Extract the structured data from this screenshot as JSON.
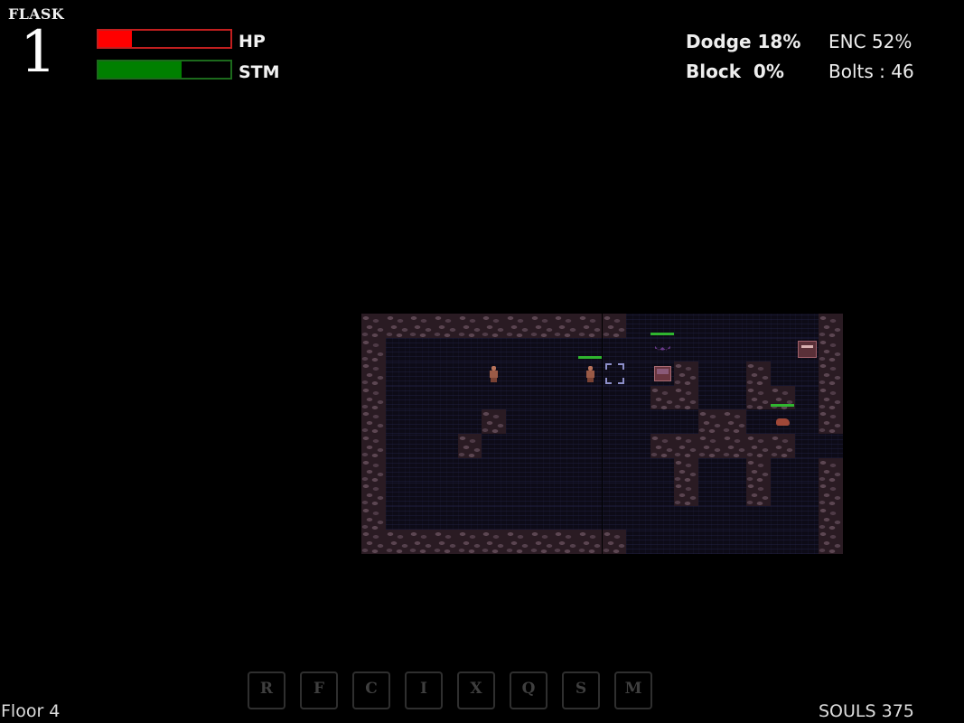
{
  "hud": {
    "flask_label": "FLASK",
    "flask_count": "1",
    "hp_label": "HP",
    "hp_fraction": 0.25,
    "hp_color": "#ff0000",
    "stm_label": "STM",
    "stm_fraction": 0.63,
    "stm_color": "#008000",
    "dodge": "Dodge 18%",
    "block": "Block  0%",
    "enc": "ENC 52%",
    "bolts": "Bolts : 46",
    "floor": "Floor 4",
    "souls": "SOULS 375"
  },
  "hotkeys": [
    {
      "key": "R"
    },
    {
      "key": "F"
    },
    {
      "key": "C"
    },
    {
      "key": "I"
    },
    {
      "key": "X"
    },
    {
      "key": "Q"
    },
    {
      "key": "S"
    },
    {
      "key": "M"
    }
  ],
  "map": {
    "legend": {
      "#": "wall",
      ".": "floor"
    },
    "rows": [
      "###########........#",
      "#..................#",
      "#............#..#..#",
      "#...........##..##.#",
      "#....#........##...#",
      "#...#.......######..",
      "#............#..#..#",
      "#............#..#..#",
      "#..................#",
      "###########........#"
    ],
    "entities": [
      {
        "type": "npc-hollow",
        "col": 5,
        "row": 2,
        "health": null
      },
      {
        "type": "player",
        "col": 9,
        "row": 2,
        "health": 1.0
      },
      {
        "type": "target-cursor",
        "col": 10,
        "row": 2,
        "health": null
      },
      {
        "type": "bat",
        "col": 12,
        "row": 1,
        "health": 1.0
      },
      {
        "type": "chest",
        "col": 12,
        "row": 2,
        "health": null
      },
      {
        "type": "mimic",
        "col": 18,
        "row": 1,
        "health": null
      },
      {
        "type": "crawler",
        "col": 17,
        "row": 4,
        "health": 1.0
      }
    ]
  }
}
